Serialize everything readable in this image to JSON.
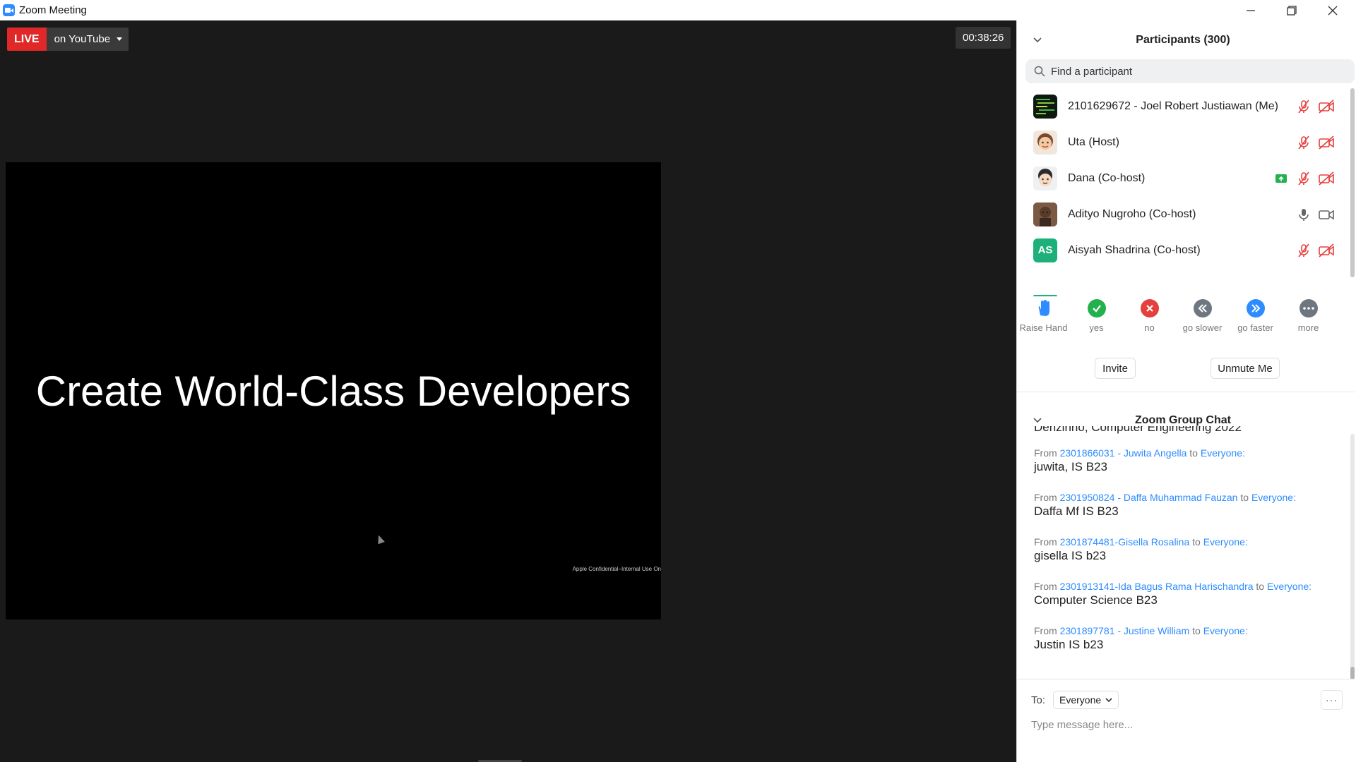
{
  "window": {
    "title": "Zoom Meeting"
  },
  "stream": {
    "live_label": "LIVE",
    "platform": "on YouTube",
    "timer": "00:38:26"
  },
  "slide": {
    "title": "Create World-Class Developers",
    "footer": "Apple Confidential–Internal Use On"
  },
  "participants": {
    "title": "Participants (300)",
    "search_placeholder": "Find a participant",
    "list": [
      {
        "name": "2101629672 - Joel Robert Justiawan (Me)",
        "avatar": "code-screenshot",
        "share": false,
        "muted": true,
        "video_off": true
      },
      {
        "name": "Uta (Host)",
        "avatar": "memoji-woman",
        "share": false,
        "muted": true,
        "video_off": true
      },
      {
        "name": "Dana (Co-host)",
        "avatar": "memoji-man",
        "share": true,
        "muted": true,
        "video_off": true
      },
      {
        "name": "Adityo Nugroho (Co-host)",
        "avatar": "photo",
        "share": false,
        "muted": false,
        "video_off": false
      },
      {
        "name": "Aisyah Shadrina (Co-host)",
        "avatar": "initials",
        "initials": "AS",
        "share": false,
        "muted": true,
        "video_off": true
      }
    ]
  },
  "reactions": [
    {
      "label": "Raise Hand",
      "icon": "raise-hand-icon",
      "color": "#2d8cff"
    },
    {
      "label": "yes",
      "icon": "check-icon",
      "color": "#23b14d"
    },
    {
      "label": "no",
      "icon": "x-icon",
      "color": "#e5403d"
    },
    {
      "label": "go slower",
      "icon": "rewind-icon",
      "color": "#6e7680"
    },
    {
      "label": "go faster",
      "icon": "fast-forward-icon",
      "color": "#2d8cff"
    },
    {
      "label": "more",
      "icon": "more-icon",
      "color": "#6e7680"
    }
  ],
  "buttons": {
    "invite": "Invite",
    "unmute": "Unmute Me"
  },
  "chat": {
    "title": "Zoom Group Chat",
    "partial_line": "Denzinho, Computer Engineering 2022",
    "from_word": "From",
    "to_word": "to",
    "messages": [
      {
        "from": "2301866031 - Juwita Angella",
        "to": "Everyone:",
        "text": "juwita, IS B23"
      },
      {
        "from": "2301950824 - Daffa Muhammad Fauzan",
        "to": "Everyone:",
        "text": "Daffa Mf IS B23"
      },
      {
        "from": "2301874481-Gisella Rosalina",
        "to": "Everyone:",
        "text": "gisella IS b23"
      },
      {
        "from": "2301913141-Ida Bagus Rama Harischandra",
        "to": "Everyone:",
        "text": "Computer Science B23"
      },
      {
        "from": "2301897781 - Justine William",
        "to": "Everyone:",
        "text": "Justin IS b23"
      }
    ],
    "to_label": "To:",
    "recipient": "Everyone",
    "input_placeholder": "Type message here...",
    "more": "···"
  },
  "colors": {
    "accent": "#2d8cff",
    "live": "#e02828",
    "muted": "#e5403d",
    "share": "#23b14d"
  }
}
